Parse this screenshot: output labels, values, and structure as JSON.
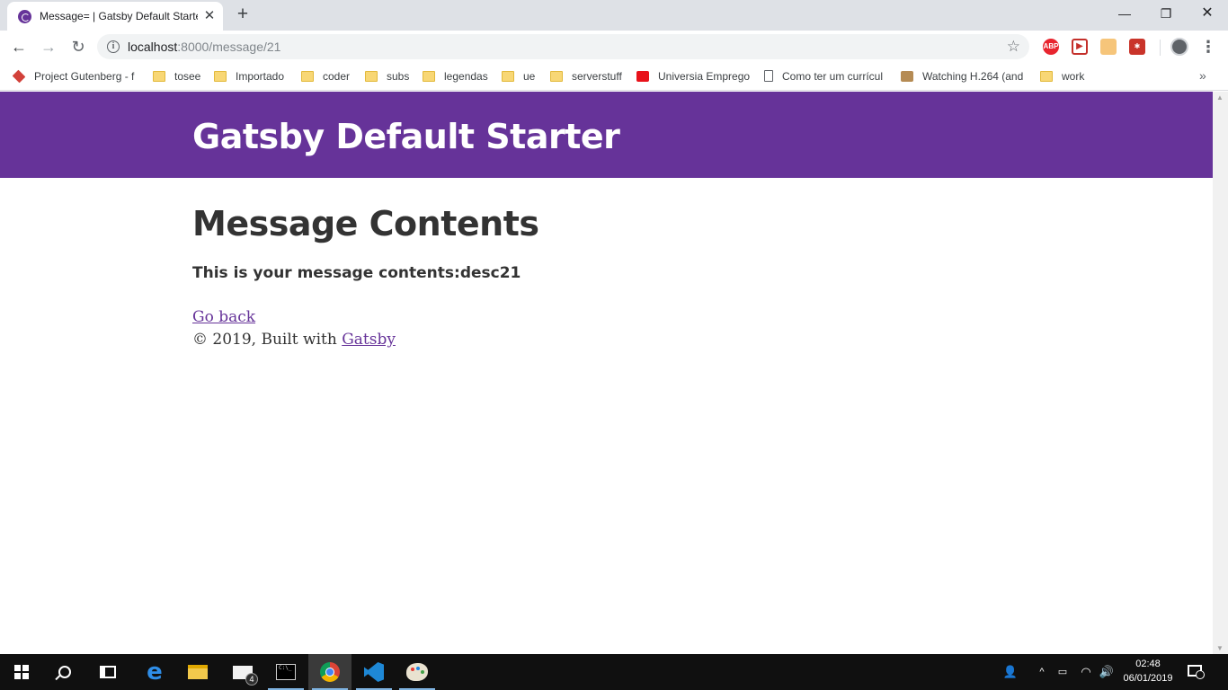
{
  "browser": {
    "tab": {
      "title": "Message= | Gatsby Default Starter",
      "close_glyph": "✕"
    },
    "new_tab_glyph": "+",
    "window": {
      "minimize": "—",
      "maximize": "❐",
      "close": "✕"
    },
    "nav": {
      "back": "←",
      "forward": "→",
      "reload": "↻"
    },
    "address": {
      "host": "localhost",
      "path": ":8000/message/21",
      "info_glyph": "i"
    },
    "star_glyph": "☆",
    "extensions": [
      {
        "name": "adblock-plus-icon",
        "label": "ABP"
      },
      {
        "name": "youtube-extension-icon",
        "label": "▶"
      },
      {
        "name": "honey-extension-icon",
        "label": "⬛"
      },
      {
        "name": "red-extension-icon",
        "label": "✱"
      }
    ],
    "menu_glyph": "⋮",
    "bookmarks": [
      {
        "label": "Project Gutenberg - f",
        "icon": "gutenberg-icon"
      },
      {
        "label": "tosee",
        "icon": "folder-icon"
      },
      {
        "label": "Importado",
        "icon": "folder-icon"
      },
      {
        "label": "coder",
        "icon": "folder-icon"
      },
      {
        "label": "subs",
        "icon": "folder-icon"
      },
      {
        "label": "legendas",
        "icon": "folder-icon"
      },
      {
        "label": "ue",
        "icon": "folder-icon"
      },
      {
        "label": "serverstuff",
        "icon": "folder-icon"
      },
      {
        "label": "Universia Emprego",
        "icon": "universia-icon"
      },
      {
        "label": "Como ter um currícul",
        "icon": "page-icon"
      },
      {
        "label": "Watching H.264 (and",
        "icon": "watching-icon"
      },
      {
        "label": "work",
        "icon": "folder-icon"
      }
    ],
    "bookmarks_more": "»"
  },
  "page": {
    "site_title": "Gatsby Default Starter",
    "heading": "Message Contents",
    "message": "This is your message contents:desc21",
    "go_back": "Go back",
    "footer_prefix": "© 2019, Built with ",
    "footer_link": "Gatsby",
    "colors": {
      "header_bg": "#663399",
      "link": "#663399",
      "text": "#333333"
    }
  },
  "taskbar": {
    "mail_badge": "4",
    "clock_time": "02:48",
    "clock_date": "06/01/2019",
    "tray_chevron": "^",
    "tray_people": "👤",
    "tray_wifi": "◠",
    "tray_volume": "🔊",
    "tray_battery": "▭"
  }
}
